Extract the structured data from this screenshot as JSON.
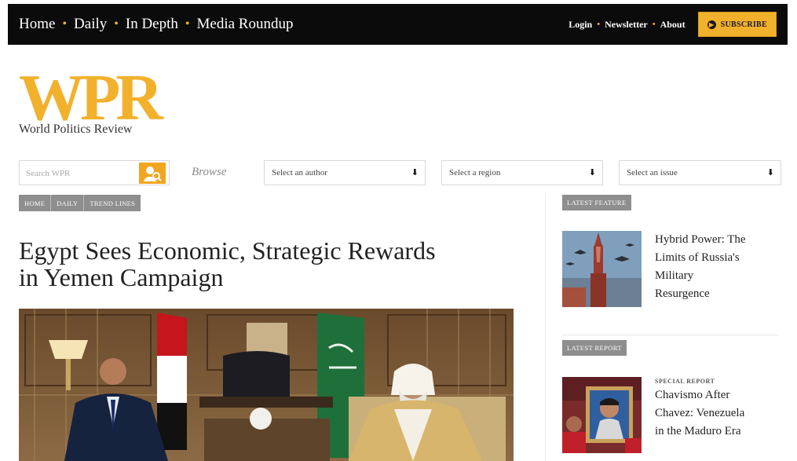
{
  "topnav": {
    "left": [
      "Home",
      "Daily",
      "In Depth",
      "Media Roundup"
    ],
    "right": [
      "Login",
      "Newsletter",
      "About"
    ],
    "subscribe_label": "SUBSCRIBE"
  },
  "brand": {
    "logo_text": "WPR",
    "tagline": "World Politics Review",
    "accent_color": "#f2b12c"
  },
  "search": {
    "placeholder": "Search WPR"
  },
  "browse": {
    "label": "Browse",
    "selects": [
      "Select an author",
      "Select a region",
      "Select an issue"
    ]
  },
  "breadcrumb": [
    "HOME",
    "DAILY",
    "TREND LINES"
  ],
  "article": {
    "headline_line1": "Egypt Sees Economic, Strategic Rewards",
    "headline_line2": "in Yemen Campaign"
  },
  "sidebar": {
    "feature_tag": "LATEST FEATURE",
    "feature_title_lines": [
      "Hybrid Power: The",
      "Limits of Russia's",
      "Military",
      "Resurgence"
    ],
    "report_tag": "LATEST REPORT",
    "report_kicker": "SPECIAL REPORT",
    "report_title_lines": [
      "Chavismo After",
      "Chavez: Venezuela",
      "in the Maduro Era"
    ]
  },
  "icons": {
    "search_button": "search-person-icon",
    "select_arrow": "arrow-down-icon",
    "subscribe": "play-circle-icon"
  }
}
